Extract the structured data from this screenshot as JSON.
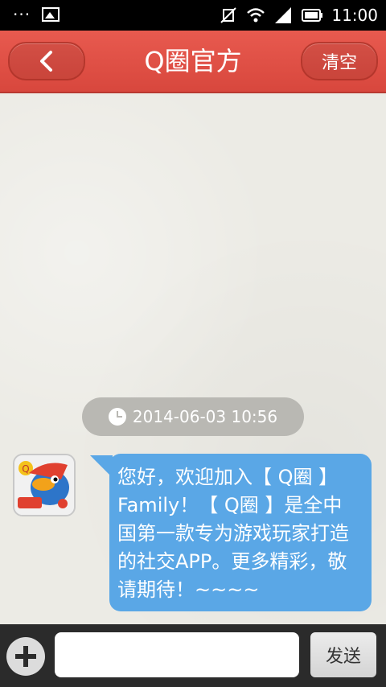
{
  "status_bar": {
    "time": "11:00",
    "left_dots": "···",
    "icons": [
      "image-icon",
      "vibrate-off-icon",
      "wifi-icon",
      "signal-icon",
      "battery-icon"
    ]
  },
  "header": {
    "title": "Q圈官方",
    "back_icon": "chevron-left-icon",
    "clear_label": "清空",
    "color": "#e0503f"
  },
  "chat": {
    "timestamp": "2014-06-03 10:56",
    "message": {
      "text": "您好，欢迎加入【 Q圈 】Family！【 Q圈 】是全中国第一款专为游戏玩家打造的社交APP。更多精彩，敬请期待！~~~~",
      "bubble_color": "#5aa7e6"
    }
  },
  "input_bar": {
    "placeholder": "",
    "send_label": "发送",
    "add_icon": "plus-icon"
  }
}
